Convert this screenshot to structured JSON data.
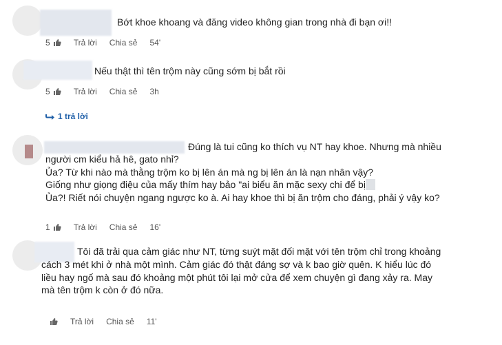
{
  "comments": [
    {
      "lines": [
        "Bớt khoe khoang và đăng video không gian trong nhà đi bạn ơi!!"
      ],
      "likes": "5",
      "reply_label": "Trả lời",
      "share_label": "Chia sẻ",
      "time": "54'"
    },
    {
      "lines": [
        "Nếu thật thì tên trộm này cũng sớm bị bắt rồi"
      ],
      "likes": "5",
      "reply_label": "Trả lời",
      "share_label": "Chia sẻ",
      "time": "3h",
      "replies_link": "1 trả lời"
    },
    {
      "lines": [
        "Đúng là tui cũng ko thích vụ NT hay khoe. Nhưng mà nhiều",
        "người cm kiểu hả hê, gato nhỉ?",
        "Ủa? Từ khi nào mà thằng trộm ko bị lên án mà ng bị lên án là nạn nhân vậy?",
        "Giống như giọng điệu của mấy thím hay bảo \"ai biểu ăn mặc sexy chi để bị",
        "Ủa?! Riết nói chuyện ngang ngược ko à. Ai hay khoe thì bị ăn trộm cho đáng, phải ý vậy ko?"
      ],
      "likes": "1",
      "reply_label": "Trả lời",
      "share_label": "Chia sẻ",
      "time": "16'"
    },
    {
      "lines": [
        "Tôi đã trải qua cảm giác như NT, từng suýt mặt đối mặt với tên trộm chỉ trong khoảng",
        "cách 3 mét khi ở nhà một mình. Cảm giác đó thật đáng sợ và k bao giờ quên. K hiểu lúc đó",
        "liều hay ngố mà sau đó khoảng một phút tôi lại mở cửa để xem chuyện gì đang xảy ra. May",
        "mà tên trộm k còn ở đó nữa."
      ],
      "likes": "",
      "reply_label": "Trả lời",
      "share_label": "Chia sẻ",
      "time": "11'"
    }
  ],
  "icons": {
    "like": "thumbs-up-icon",
    "reply_arrow": "reply-arrow-icon"
  },
  "colors": {
    "link": "#1f5fa8",
    "text": "#222222",
    "meta": "#555555"
  }
}
